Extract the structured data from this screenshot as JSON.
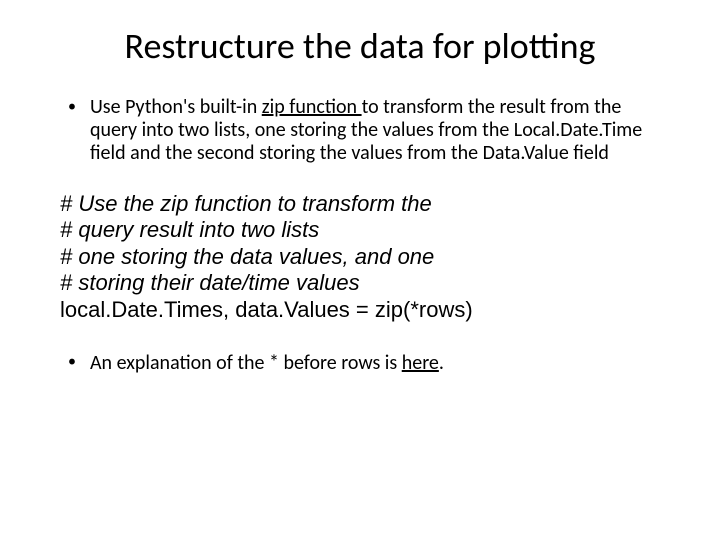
{
  "title": "Restructure the data for plotting",
  "bullet1": {
    "pre": "Use Python's built-in ",
    "link": "zip function ",
    "post": "to transform the result from the query into two lists, one storing the values from the Local.Date.Time field and the second storing the values from the Data.Value field"
  },
  "code": {
    "line1": "# Use the zip function to transform the",
    "line2": "# query result into two lists",
    "line3": "# one storing the data values, and one",
    "line4": "# storing their date/time values",
    "line5": "local.Date.Times, data.Values = zip(*rows)"
  },
  "bullet2": {
    "pre": "An explanation of the * before rows is ",
    "link": "here",
    "post": "."
  }
}
